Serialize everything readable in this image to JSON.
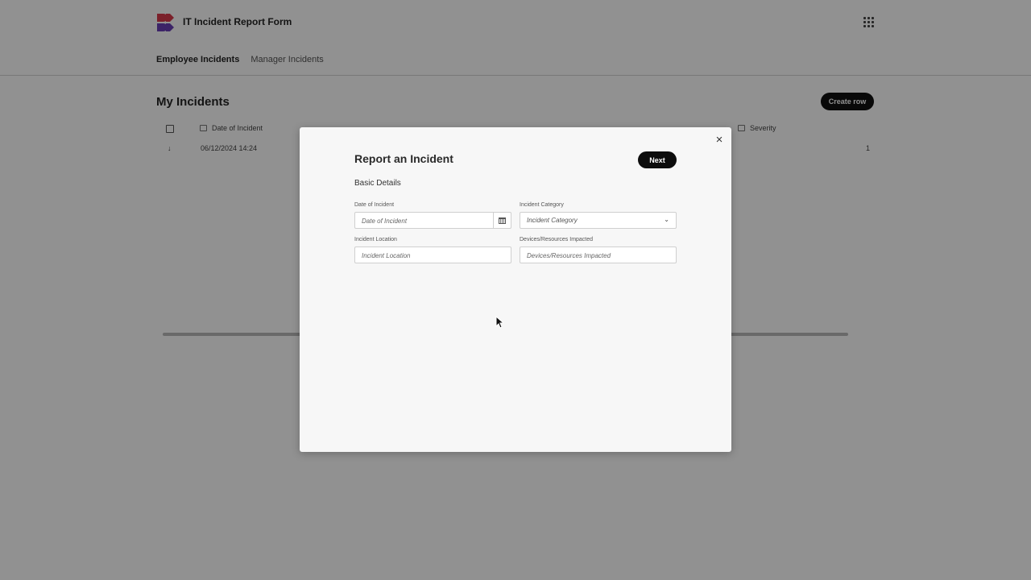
{
  "app": {
    "title": "IT Incident Report Form",
    "tabs": [
      {
        "label": "Employee Incidents",
        "active": true
      },
      {
        "label": "Manager Incidents",
        "active": false
      }
    ]
  },
  "list": {
    "title": "My Incidents",
    "create_label": "Create row",
    "columns": [
      "Date of Incident",
      "Severity"
    ],
    "rows": [
      {
        "date": "06/12/2024 14:24",
        "severity": "1"
      }
    ]
  },
  "modal": {
    "title": "Report an Incident",
    "next_label": "Next",
    "close_glyph": "×",
    "section": "Basic Details",
    "fields": {
      "date": {
        "label": "Date of Incident",
        "placeholder": "Date of Incident"
      },
      "category": {
        "label": "Incident Category",
        "placeholder": "Incident Category"
      },
      "location": {
        "label": "Incident Location",
        "placeholder": "Incident Location"
      },
      "devices": {
        "label": "Devices/Resources Impacted",
        "placeholder": "Devices/Resources Impacted"
      }
    }
  },
  "colors": {
    "logo_red": "#d9394b",
    "logo_purple": "#6a3fb5",
    "button_dark": "#0d0d0d",
    "overlay": "rgba(0,0,0,0.43)"
  }
}
